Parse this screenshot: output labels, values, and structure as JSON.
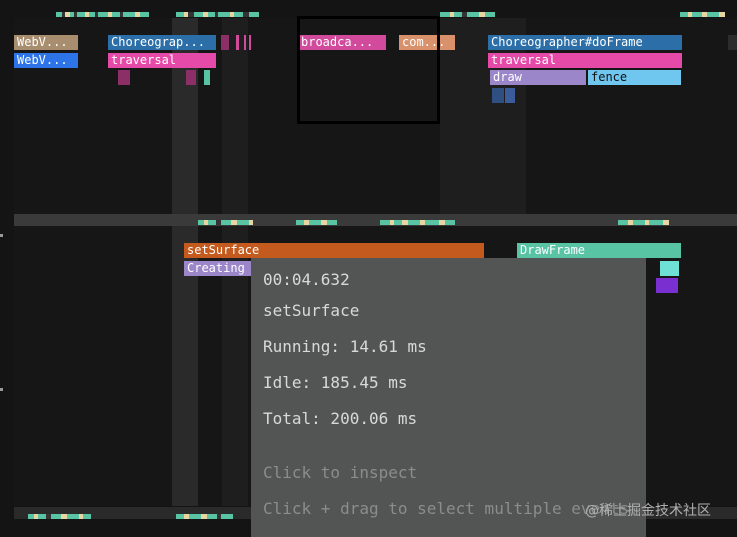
{
  "colors": {
    "background": "#141414",
    "choreographer": "#2c6fa8",
    "traversal": "#e64aa8",
    "draw": "#9a86c9",
    "fence": "#6fc7f0",
    "webview_tan": "#a98d6f",
    "webview_blue": "#2c74e8",
    "broadcast": "#d14a9c",
    "com_orange": "#d8916a",
    "set_surface": "#c55a1e",
    "creating": "#9a86c9",
    "draw_frame": "#58c4a3",
    "tooltip_bg": "#535554"
  },
  "top_track": {
    "slices": {
      "webview_1": "WebV...",
      "webview_2": "WebV...",
      "choreographer_short": "Choreograp...",
      "traversal_left": "traversal",
      "broadcast": "broadca...",
      "com": "com...",
      "choreographer_full": "Choreographer#doFrame",
      "traversal_right": "traversal",
      "draw": "draw",
      "fence": "fence"
    }
  },
  "bottom_track": {
    "slices": {
      "set_surface": "setSurface",
      "creating": "Creating",
      "draw_frame": "DrawFrame"
    }
  },
  "tooltip": {
    "timestamp": "00:04.632",
    "name": "setSurface",
    "running": "Running: 14.61 ms",
    "idle": "Idle: 185.45 ms",
    "total": "Total: 200.06 ms",
    "hint_click": "Click to inspect",
    "hint_drag": "Click + drag to select multiple events"
  },
  "watermark": "@稀土掘金技术社区"
}
